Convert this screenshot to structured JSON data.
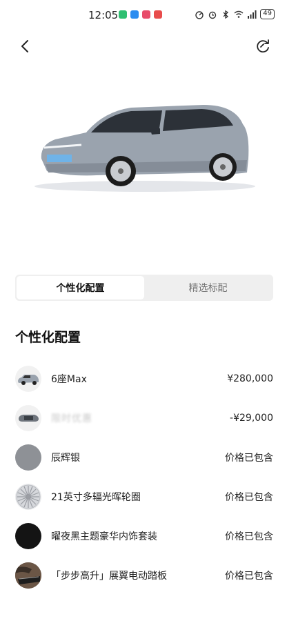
{
  "status_bar": {
    "time": "12:05",
    "battery": "49",
    "app_colors": [
      "#2fbf71",
      "#2a8cf0",
      "#e84c6a",
      "#e84c4c"
    ]
  },
  "nav": {
    "back_icon": "chevron-left-icon",
    "refresh_icon": "refresh-icon"
  },
  "car": {
    "body_color": "#9aa3ae",
    "plate_color": "#6fb3e8"
  },
  "tabs": [
    {
      "label": "个性化配置",
      "active": true
    },
    {
      "label": "精选标配",
      "active": false
    }
  ],
  "section": {
    "title": "个性化配置"
  },
  "config_items": [
    {
      "label": "6座Max",
      "value": "¥280,000",
      "thumb": "car-thumb-icon"
    },
    {
      "label": "限时优惠",
      "value": "-¥29,000",
      "thumb": "car-roof-thumb-icon",
      "blurred": true
    },
    {
      "label": "辰辉银",
      "value": "价格已包含",
      "thumb": "silver-swatch",
      "color": "#8e9196"
    },
    {
      "label": "21英寸多辐光晖轮圈",
      "value": "价格已包含",
      "thumb": "wheel-icon"
    },
    {
      "label": "曜夜黑主题豪华内饰套装",
      "value": "价格已包含",
      "thumb": "black-swatch",
      "color": "#141414"
    },
    {
      "label": "「步步高升」展翼电动踏板",
      "value": "价格已包含",
      "thumb": "step-board-thumb-icon"
    }
  ]
}
